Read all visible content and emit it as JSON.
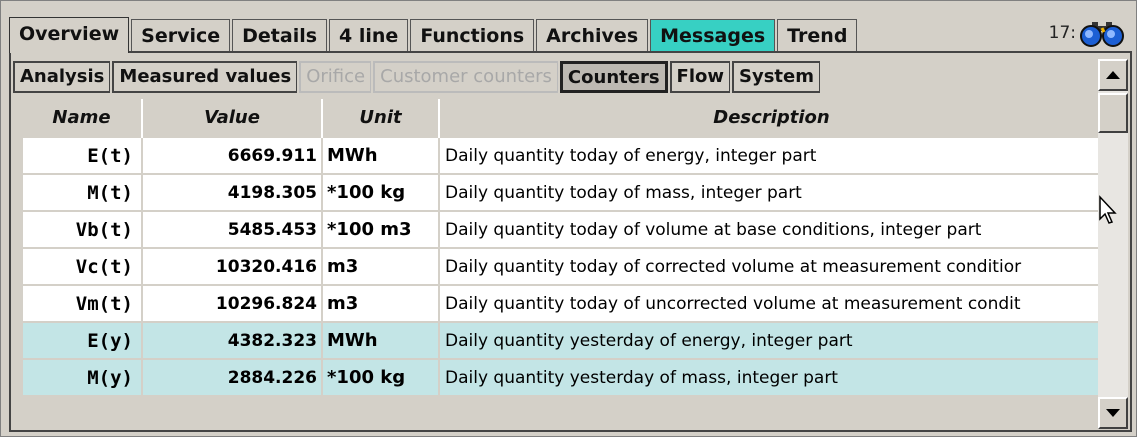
{
  "top_tabs": [
    {
      "label": "Overview",
      "active": true
    },
    {
      "label": "Service"
    },
    {
      "label": "Details"
    },
    {
      "label": "4 line"
    },
    {
      "label": "Functions"
    },
    {
      "label": "Archives"
    },
    {
      "label": "Messages",
      "highlight": true
    },
    {
      "label": "Trend"
    }
  ],
  "clock": "17:",
  "sub_tabs": [
    {
      "label": "Analysis"
    },
    {
      "label": "Measured values"
    },
    {
      "label": "Orifice",
      "disabled": true
    },
    {
      "label": "Customer counters",
      "disabled": true
    },
    {
      "label": "Counters",
      "active": true
    },
    {
      "label": "Flow"
    },
    {
      "label": "System"
    }
  ],
  "table": {
    "headers": {
      "name": "Name",
      "value": "Value",
      "unit": "Unit",
      "description": "Description"
    },
    "rows": [
      {
        "name": "E(t)",
        "value": "6669.911",
        "unit": "MWh",
        "description": "Daily quantity today of energy, integer part"
      },
      {
        "name": "M(t)",
        "value": "4198.305",
        "unit": "*100 kg",
        "description": "Daily quantity today of mass, integer part"
      },
      {
        "name": "Vb(t)",
        "value": "5485.453",
        "unit": "*100 m3",
        "description": "Daily quantity today of volume at base conditions, integer part"
      },
      {
        "name": "Vc(t)",
        "value": "10320.416",
        "unit": "m3",
        "description": "Daily quantity today of corrected volume at measurement conditior"
      },
      {
        "name": "Vm(t)",
        "value": "10296.824",
        "unit": "m3",
        "description": "Daily quantity today of uncorrected volume at measurement condit"
      },
      {
        "name": "E(y)",
        "value": "4382.323",
        "unit": "MWh",
        "description": "Daily quantity yesterday of energy, integer part",
        "highlight": true
      },
      {
        "name": "M(y)",
        "value": "2884.226",
        "unit": "*100 kg",
        "description": "Daily quantity yesterday of mass, integer part",
        "highlight": true
      }
    ]
  },
  "colors": {
    "highlight_tab": "#37d0c3",
    "highlight_row": "#c3e5e6",
    "background": "#d4d0c8"
  }
}
